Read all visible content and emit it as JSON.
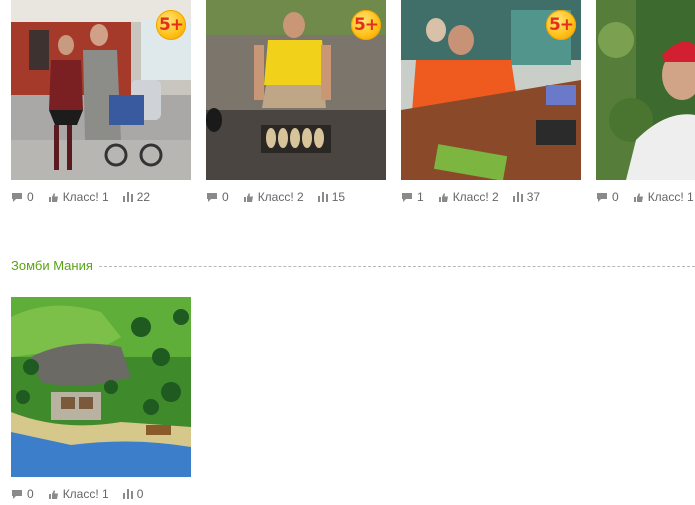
{
  "photos": [
    {
      "badge": "5+",
      "comments": "0",
      "likes": "Класс! 1",
      "views": "22"
    },
    {
      "badge": "5+",
      "comments": "0",
      "likes": "Класс! 2",
      "views": "15"
    },
    {
      "badge": "5+",
      "comments": "1",
      "likes": "Класс! 2",
      "views": "37"
    },
    {
      "badge": "",
      "comments": "0",
      "likes": "Класс! 1",
      "views": ""
    }
  ],
  "section": {
    "title": "Зомби Мания",
    "photo": {
      "comments": "0",
      "likes": "Класс! 1",
      "views": "0"
    }
  },
  "colors": {
    "accent_green": "#5aa316",
    "badge_orange": "#ffc21a",
    "badge_text": "#e2301c"
  }
}
